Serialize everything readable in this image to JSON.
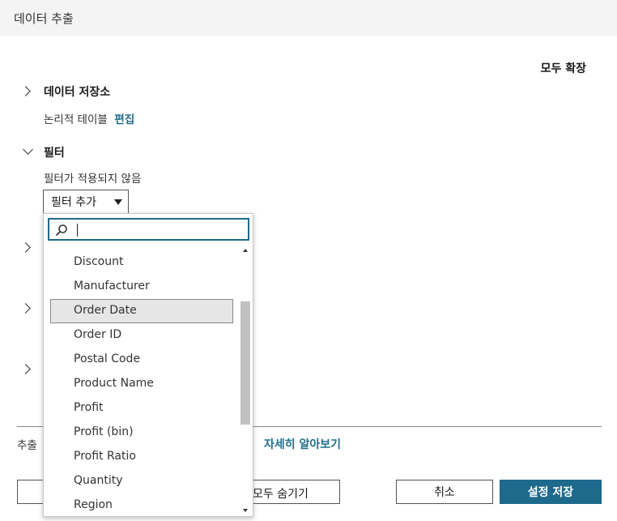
{
  "dialog": {
    "title": "데이터 추출"
  },
  "expand_all": "모두 확장",
  "data_storage": {
    "title": "데이터 저장소",
    "subtitle": "논리적 테이블",
    "edit_link": "편집"
  },
  "filters": {
    "title": "필터",
    "status": "필터가 적용되지 않음",
    "add_button": "필터 추가"
  },
  "footer": {
    "text": "추출",
    "learn_more": "자세히 알아보기",
    "hide_all": "모두 숨기기",
    "cancel": "취소",
    "save": "설정 저장"
  },
  "dropdown": {
    "search_value": "",
    "items": [
      "Discount",
      "Manufacturer",
      "Order Date",
      "Order ID",
      "Postal Code",
      "Product Name",
      "Profit",
      "Profit (bin)",
      "Profit Ratio",
      "Quantity",
      "Region"
    ],
    "highlighted": "Order Date"
  },
  "colors": {
    "accent": "#1d6a8c",
    "link": "#1f6f8b",
    "titlebar": "#f4f4f4"
  }
}
